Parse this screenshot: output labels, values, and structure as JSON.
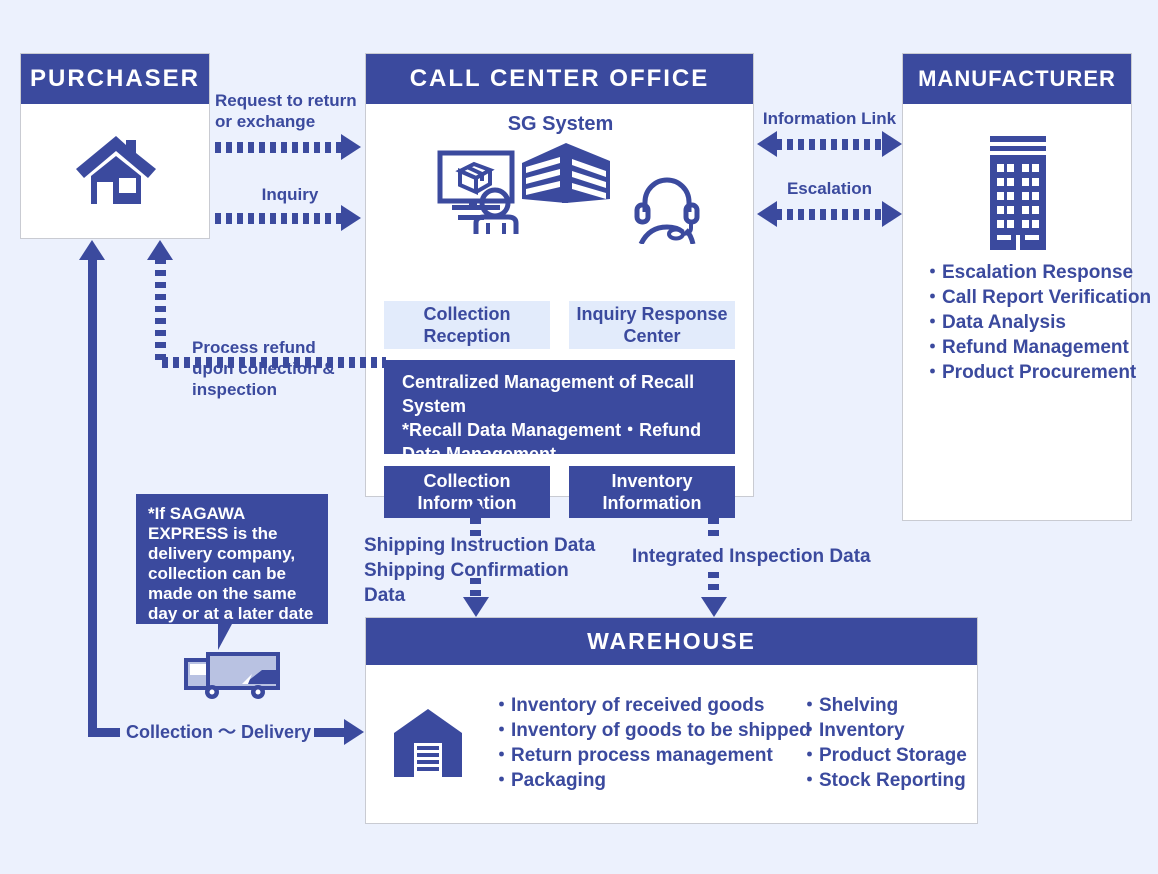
{
  "palette": {
    "brand_blue": "#3b4a9e",
    "page_background": "#ecf1fd",
    "light_box": "#e2ebfb",
    "panel_white": "#ffffff",
    "truck_body": "#b9c2e2"
  },
  "panels": {
    "purchaser": {
      "title": "PURCHASER",
      "icon": "house-icon"
    },
    "call_center": {
      "title": "CALL CENTER OFFICE",
      "system_label": "SG System",
      "icons": [
        "desk-agent-package-icon",
        "office-building-icon",
        "headset-operator-icon"
      ],
      "light_boxes": [
        {
          "line1": "Collection",
          "line2": "Reception"
        },
        {
          "line1": "Inquiry Response",
          "line2": "Center"
        }
      ],
      "central_block": {
        "line1": "Centralized Management of Recall",
        "line2": "System",
        "line3": "*Recall Data Management・Refund",
        "line4": "Data Management"
      },
      "dark_boxes": [
        {
          "line1": "Collection",
          "line2": "Information"
        },
        {
          "line1": "Inventory",
          "line2": "Information"
        }
      ]
    },
    "manufacturer": {
      "title": "MANUFACTURER",
      "icon": "tall-building-icon",
      "bullets": [
        "・Escalation Response",
        "・Call Report Verification",
        "・Data Analysis",
        "・Refund Management",
        "・Product Procurement"
      ]
    },
    "warehouse": {
      "title": "WAREHOUSE",
      "icon": "warehouse-icon",
      "bullets_left": [
        "・Inventory of received goods",
        "・Inventory of goods to be shipped",
        "・Return process management",
        "・Packaging"
      ],
      "bullets_right": [
        "・Shelving",
        "・Inventory",
        "・Product Storage",
        "・Stock Reporting"
      ]
    }
  },
  "flows": {
    "request_return_line1": "Request to return",
    "request_return_line2": "or exchange",
    "inquiry": "Inquiry",
    "information_link": "Information Link",
    "escalation": "Escalation",
    "process_refund_line1": "Process refund",
    "process_refund_line2": "upon collection &",
    "process_refund_line3": "inspection",
    "shipping_instruction": "Shipping Instruction Data",
    "shipping_confirmation": "Shipping Confirmation Data",
    "integrated_inspection": "Integrated Inspection Data",
    "collection_delivery": "Collection ～ Delivery"
  },
  "note": {
    "line1": "*If SAGAWA",
    "line2": "EXPRESS is the",
    "line3": "delivery company,",
    "line4": "collection can be",
    "line5": "made on the same",
    "line6": "day or at a later date",
    "icon": "delivery-truck-icon"
  }
}
